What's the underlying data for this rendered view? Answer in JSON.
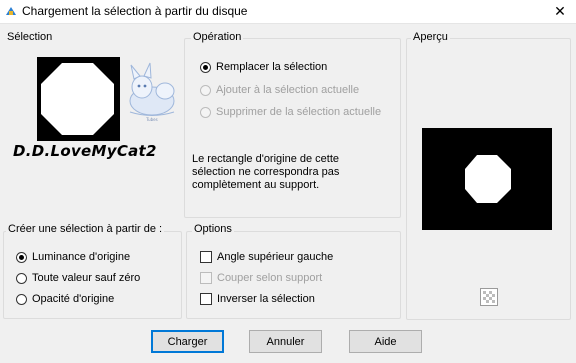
{
  "window": {
    "title": "Chargement la sélection à partir du disque",
    "close_glyph": "✕"
  },
  "selection": {
    "label": "Sélection",
    "watermark_text": "D.D.LoveMyCat2"
  },
  "operation": {
    "legend": "Opération",
    "options": [
      {
        "label": "Remplacer la sélection",
        "checked": true,
        "enabled": true
      },
      {
        "label": "Ajouter à la sélection actuelle",
        "checked": false,
        "enabled": false
      },
      {
        "label": "Supprimer de la sélection actuelle",
        "checked": false,
        "enabled": false
      }
    ],
    "message_line1": "Le rectangle d'origine de cette",
    "message_line2": "sélection ne correspondra pas",
    "message_line3": "complètement au support."
  },
  "preview": {
    "label": "Aperçu"
  },
  "create_from": {
    "legend": "Créer une sélection à partir de :",
    "options": [
      {
        "label": "Luminance d'origine",
        "checked": true
      },
      {
        "label": "Toute valeur sauf zéro",
        "checked": false
      },
      {
        "label": "Opacité d'origine",
        "checked": false
      }
    ]
  },
  "options": {
    "legend": "Options",
    "items": [
      {
        "label": "Angle supérieur gauche",
        "checked": false,
        "enabled": true
      },
      {
        "label": "Couper selon support",
        "checked": false,
        "enabled": false
      },
      {
        "label": "Inverser la sélection",
        "checked": false,
        "enabled": true
      }
    ]
  },
  "buttons": {
    "load": "Charger",
    "cancel": "Annuler",
    "help": "Aide"
  },
  "colors": {
    "accent": "#0078d7",
    "background": "#f0f0f0"
  }
}
